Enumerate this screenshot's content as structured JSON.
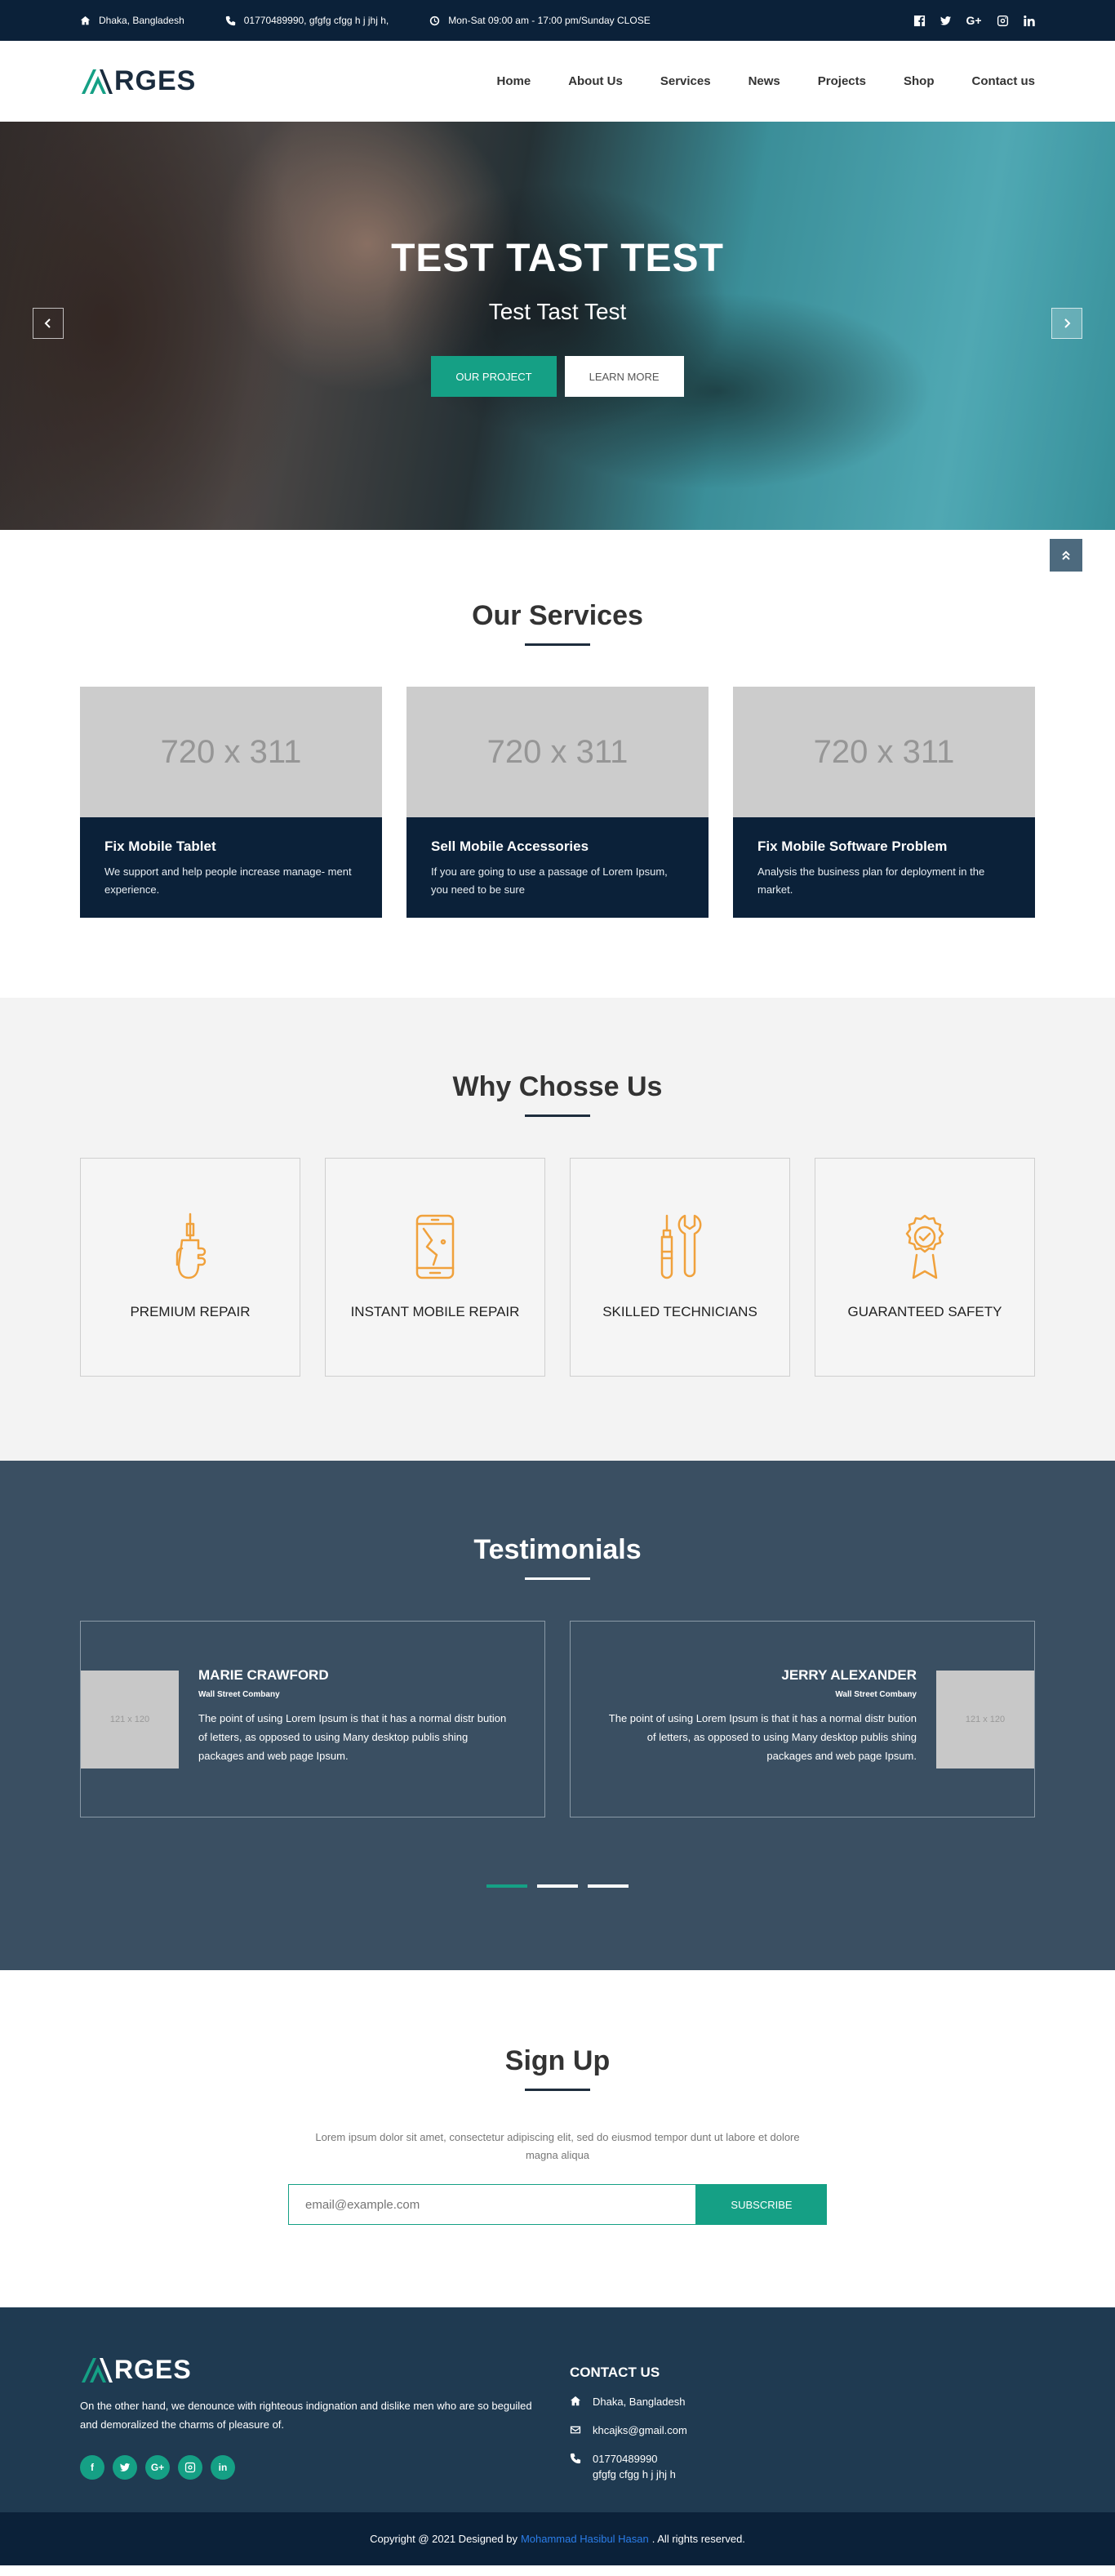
{
  "topbar": {
    "address": "Dhaka, Bangladesh",
    "phone": "01770489990,  gfgfg cfgg h j jhj h,",
    "hours": "Mon-Sat 09:00 am - 17:00 pm/Sunday CLOSE"
  },
  "nav": {
    "logo": "RGES",
    "items": [
      "Home",
      "About Us",
      "Services",
      "News",
      "Projects",
      "Shop",
      "Contact us"
    ]
  },
  "hero": {
    "title": "TEST TAST TEST",
    "subtitle": "Test Tast Test",
    "btn_primary": "OUR PROJECT",
    "btn_secondary": "LEARN MORE"
  },
  "services": {
    "title": "Our Services",
    "items": [
      {
        "image_label": "720 x 311",
        "title": "Fix Mobile Tablet",
        "text": "We support and help people increase manage- ment experience."
      },
      {
        "image_label": "720 x 311",
        "title": "Sell Mobile Accessories",
        "text": "If you are going to use a passage of Lorem Ipsum, you need to be sure"
      },
      {
        "image_label": "720 x 311",
        "title": "Fix Mobile Software Problem",
        "text": "Analysis the business plan for deployment in the market."
      }
    ]
  },
  "why": {
    "title": "Why Chosse Us",
    "items": [
      {
        "label": "PREMIUM REPAIR",
        "icon": "screwdriver-hand-icon"
      },
      {
        "label": "INSTANT MOBILE REPAIR",
        "icon": "broken-phone-icon"
      },
      {
        "label": "SKILLED TECHNICIANS",
        "icon": "tools-icon"
      },
      {
        "label": "GUARANTEED SAFETY",
        "icon": "badge-icon"
      }
    ]
  },
  "testimonials": {
    "title": "Testimonials",
    "items": [
      {
        "image_label": "121 x 120",
        "name": "MARIE CRAWFORD",
        "company": "Wall Street Combany",
        "quote": "The point of using Lorem Ipsum is that it has a normal distr bution of letters, as opposed to using Many desktop publis shing packages and web page Ipsum."
      },
      {
        "image_label": "121 x 120",
        "name": "JERRY ALEXANDER",
        "company": "Wall Street Combany",
        "quote": "The point of using Lorem Ipsum is that it has a normal distr bution of letters, as opposed to using Many desktop publis shing packages and web page Ipsum."
      }
    ]
  },
  "signup": {
    "title": "Sign Up",
    "text": "Lorem ipsum dolor sit amet, consectetur adipiscing elit, sed do eiusmod tempor dunt ut labore et dolore magna aliqua",
    "placeholder": "email@example.com",
    "button": "SUBSCRIBE"
  },
  "footer": {
    "logo": "RGES",
    "description": "On the other hand, we denounce with righteous indignation and dislike men who are so beguiled and demoralized the charms of pleasure of.",
    "contact_title": "CONTACT US",
    "address": "Dhaka, Bangladesh",
    "email": "khcajks@gmail.com",
    "phone": "01770489990",
    "phone_extra": "gfgfg cfgg h j jhj h",
    "copyright_prefix": "Copyright @ 2021 Designed by",
    "designer": "Mohammad Hasibul Hasan",
    "copyright_suffix": ". All rights reserved."
  },
  "colors": {
    "navy": "#0b2139",
    "accent": "#15a085",
    "testimonial_bg": "#3a4f62",
    "footer_bg": "#1f3a51",
    "icon_orange": "#f0a13c"
  }
}
